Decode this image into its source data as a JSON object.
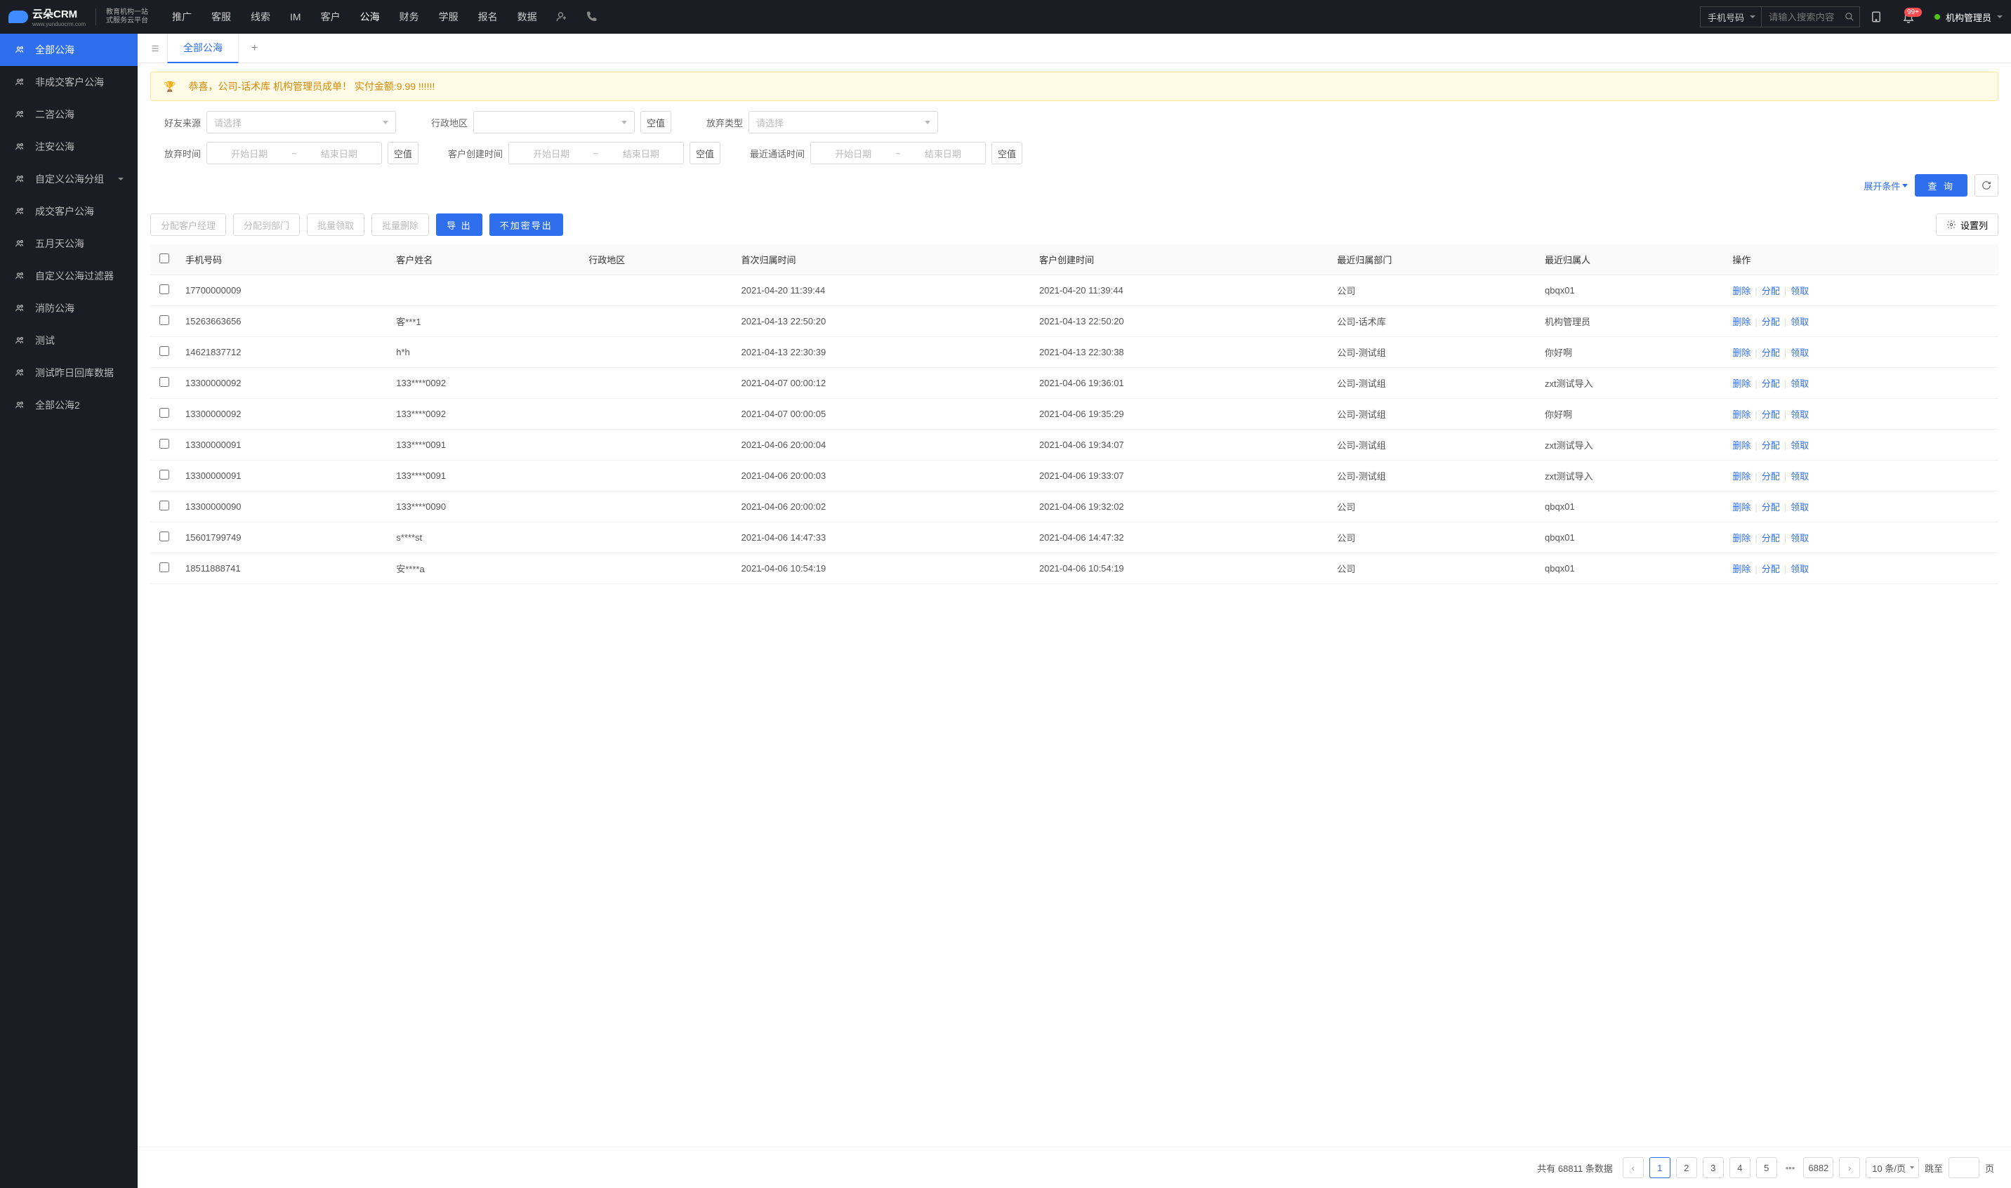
{
  "header": {
    "logo_text": "云朵CRM",
    "logo_url": "www.yunduocrm.com",
    "logo_sub1": "教育机构一站",
    "logo_sub2": "式服务云平台",
    "nav": [
      "推广",
      "客服",
      "线索",
      "IM",
      "客户",
      "公海",
      "财务",
      "学服",
      "报名",
      "数据"
    ],
    "nav_active": 5,
    "search_type": "手机号码",
    "search_placeholder": "请输入搜索内容",
    "badge": "99+",
    "user_name": "机构管理员"
  },
  "sidebar": {
    "items": [
      {
        "label": "全部公海",
        "active": true
      },
      {
        "label": "非成交客户公海"
      },
      {
        "label": "二咨公海"
      },
      {
        "label": "注安公海"
      },
      {
        "label": "自定义公海分组",
        "has_caret": true
      },
      {
        "label": "成交客户公海"
      },
      {
        "label": "五月天公海"
      },
      {
        "label": "自定义公海过滤器"
      },
      {
        "label": "消防公海"
      },
      {
        "label": "测试"
      },
      {
        "label": "测试昨日回库数据"
      },
      {
        "label": "全部公海2"
      }
    ]
  },
  "tabs": {
    "active": "全部公海"
  },
  "banner": "恭喜，公司-话术库  机构管理员成单！ 实付金额:9.99 !!!!!!",
  "filters": {
    "friend_source": {
      "label": "好友来源",
      "placeholder": "请选择"
    },
    "region": {
      "label": "行政地区"
    },
    "abandon_type": {
      "label": "放弃类型",
      "placeholder": "请选择"
    },
    "abandon_time": {
      "label": "放弃时间"
    },
    "create_time": {
      "label": "客户创建时间"
    },
    "last_call_time": {
      "label": "最近通话时间"
    },
    "date_start": "开始日期",
    "date_end": "结束日期",
    "null_btn": "空值",
    "expand": "展开条件",
    "query": "查 询"
  },
  "actions": {
    "assign_manager": "分配客户经理",
    "assign_dept": "分配到部门",
    "batch_claim": "批量领取",
    "batch_delete": "批量删除",
    "export": "导 出",
    "export_plain": "不加密导出",
    "set_cols": "设置列"
  },
  "table": {
    "headers": [
      "手机号码",
      "客户姓名",
      "行政地区",
      "首次归属时间",
      "客户创建时间",
      "最近归属部门",
      "最近归属人",
      "操作"
    ],
    "ops": {
      "delete": "删除",
      "assign": "分配",
      "claim": "领取"
    },
    "rows": [
      {
        "phone": "17700000009",
        "name": "",
        "region": "",
        "first_time": "2021-04-20 11:39:44",
        "create_time": "2021-04-20 11:39:44",
        "dept": "公司",
        "owner": "qbqx01"
      },
      {
        "phone": "15263663656",
        "name": "客***1",
        "region": "",
        "first_time": "2021-04-13 22:50:20",
        "create_time": "2021-04-13 22:50:20",
        "dept": "公司-话术库",
        "owner": "机构管理员"
      },
      {
        "phone": "14621837712",
        "name": "h*h",
        "region": "",
        "first_time": "2021-04-13 22:30:39",
        "create_time": "2021-04-13 22:30:38",
        "dept": "公司-测试组",
        "owner": "你好啊"
      },
      {
        "phone": "13300000092",
        "name": "133****0092",
        "region": "",
        "first_time": "2021-04-07 00:00:12",
        "create_time": "2021-04-06 19:36:01",
        "dept": "公司-测试组",
        "owner": "zxt测试导入"
      },
      {
        "phone": "13300000092",
        "name": "133****0092",
        "region": "",
        "first_time": "2021-04-07 00:00:05",
        "create_time": "2021-04-06 19:35:29",
        "dept": "公司-测试组",
        "owner": "你好啊"
      },
      {
        "phone": "13300000091",
        "name": "133****0091",
        "region": "",
        "first_time": "2021-04-06 20:00:04",
        "create_time": "2021-04-06 19:34:07",
        "dept": "公司-测试组",
        "owner": "zxt测试导入"
      },
      {
        "phone": "13300000091",
        "name": "133****0091",
        "region": "",
        "first_time": "2021-04-06 20:00:03",
        "create_time": "2021-04-06 19:33:07",
        "dept": "公司-测试组",
        "owner": "zxt测试导入"
      },
      {
        "phone": "13300000090",
        "name": "133****0090",
        "region": "",
        "first_time": "2021-04-06 20:00:02",
        "create_time": "2021-04-06 19:32:02",
        "dept": "公司",
        "owner": "qbqx01"
      },
      {
        "phone": "15601799749",
        "name": "s****st",
        "region": "",
        "first_time": "2021-04-06 14:47:33",
        "create_time": "2021-04-06 14:47:32",
        "dept": "公司",
        "owner": "qbqx01"
      },
      {
        "phone": "18511888741",
        "name": "安****a",
        "region": "",
        "first_time": "2021-04-06 10:54:19",
        "create_time": "2021-04-06 10:54:19",
        "dept": "公司",
        "owner": "qbqx01"
      }
    ]
  },
  "pagination": {
    "total_prefix": "共有",
    "total": "68811",
    "total_suffix": "条数据",
    "pages": [
      "1",
      "2",
      "3",
      "4",
      "5"
    ],
    "last_page": "6882",
    "per_page": "10 条/页",
    "jump_label": "跳至",
    "page_suffix": "页"
  }
}
